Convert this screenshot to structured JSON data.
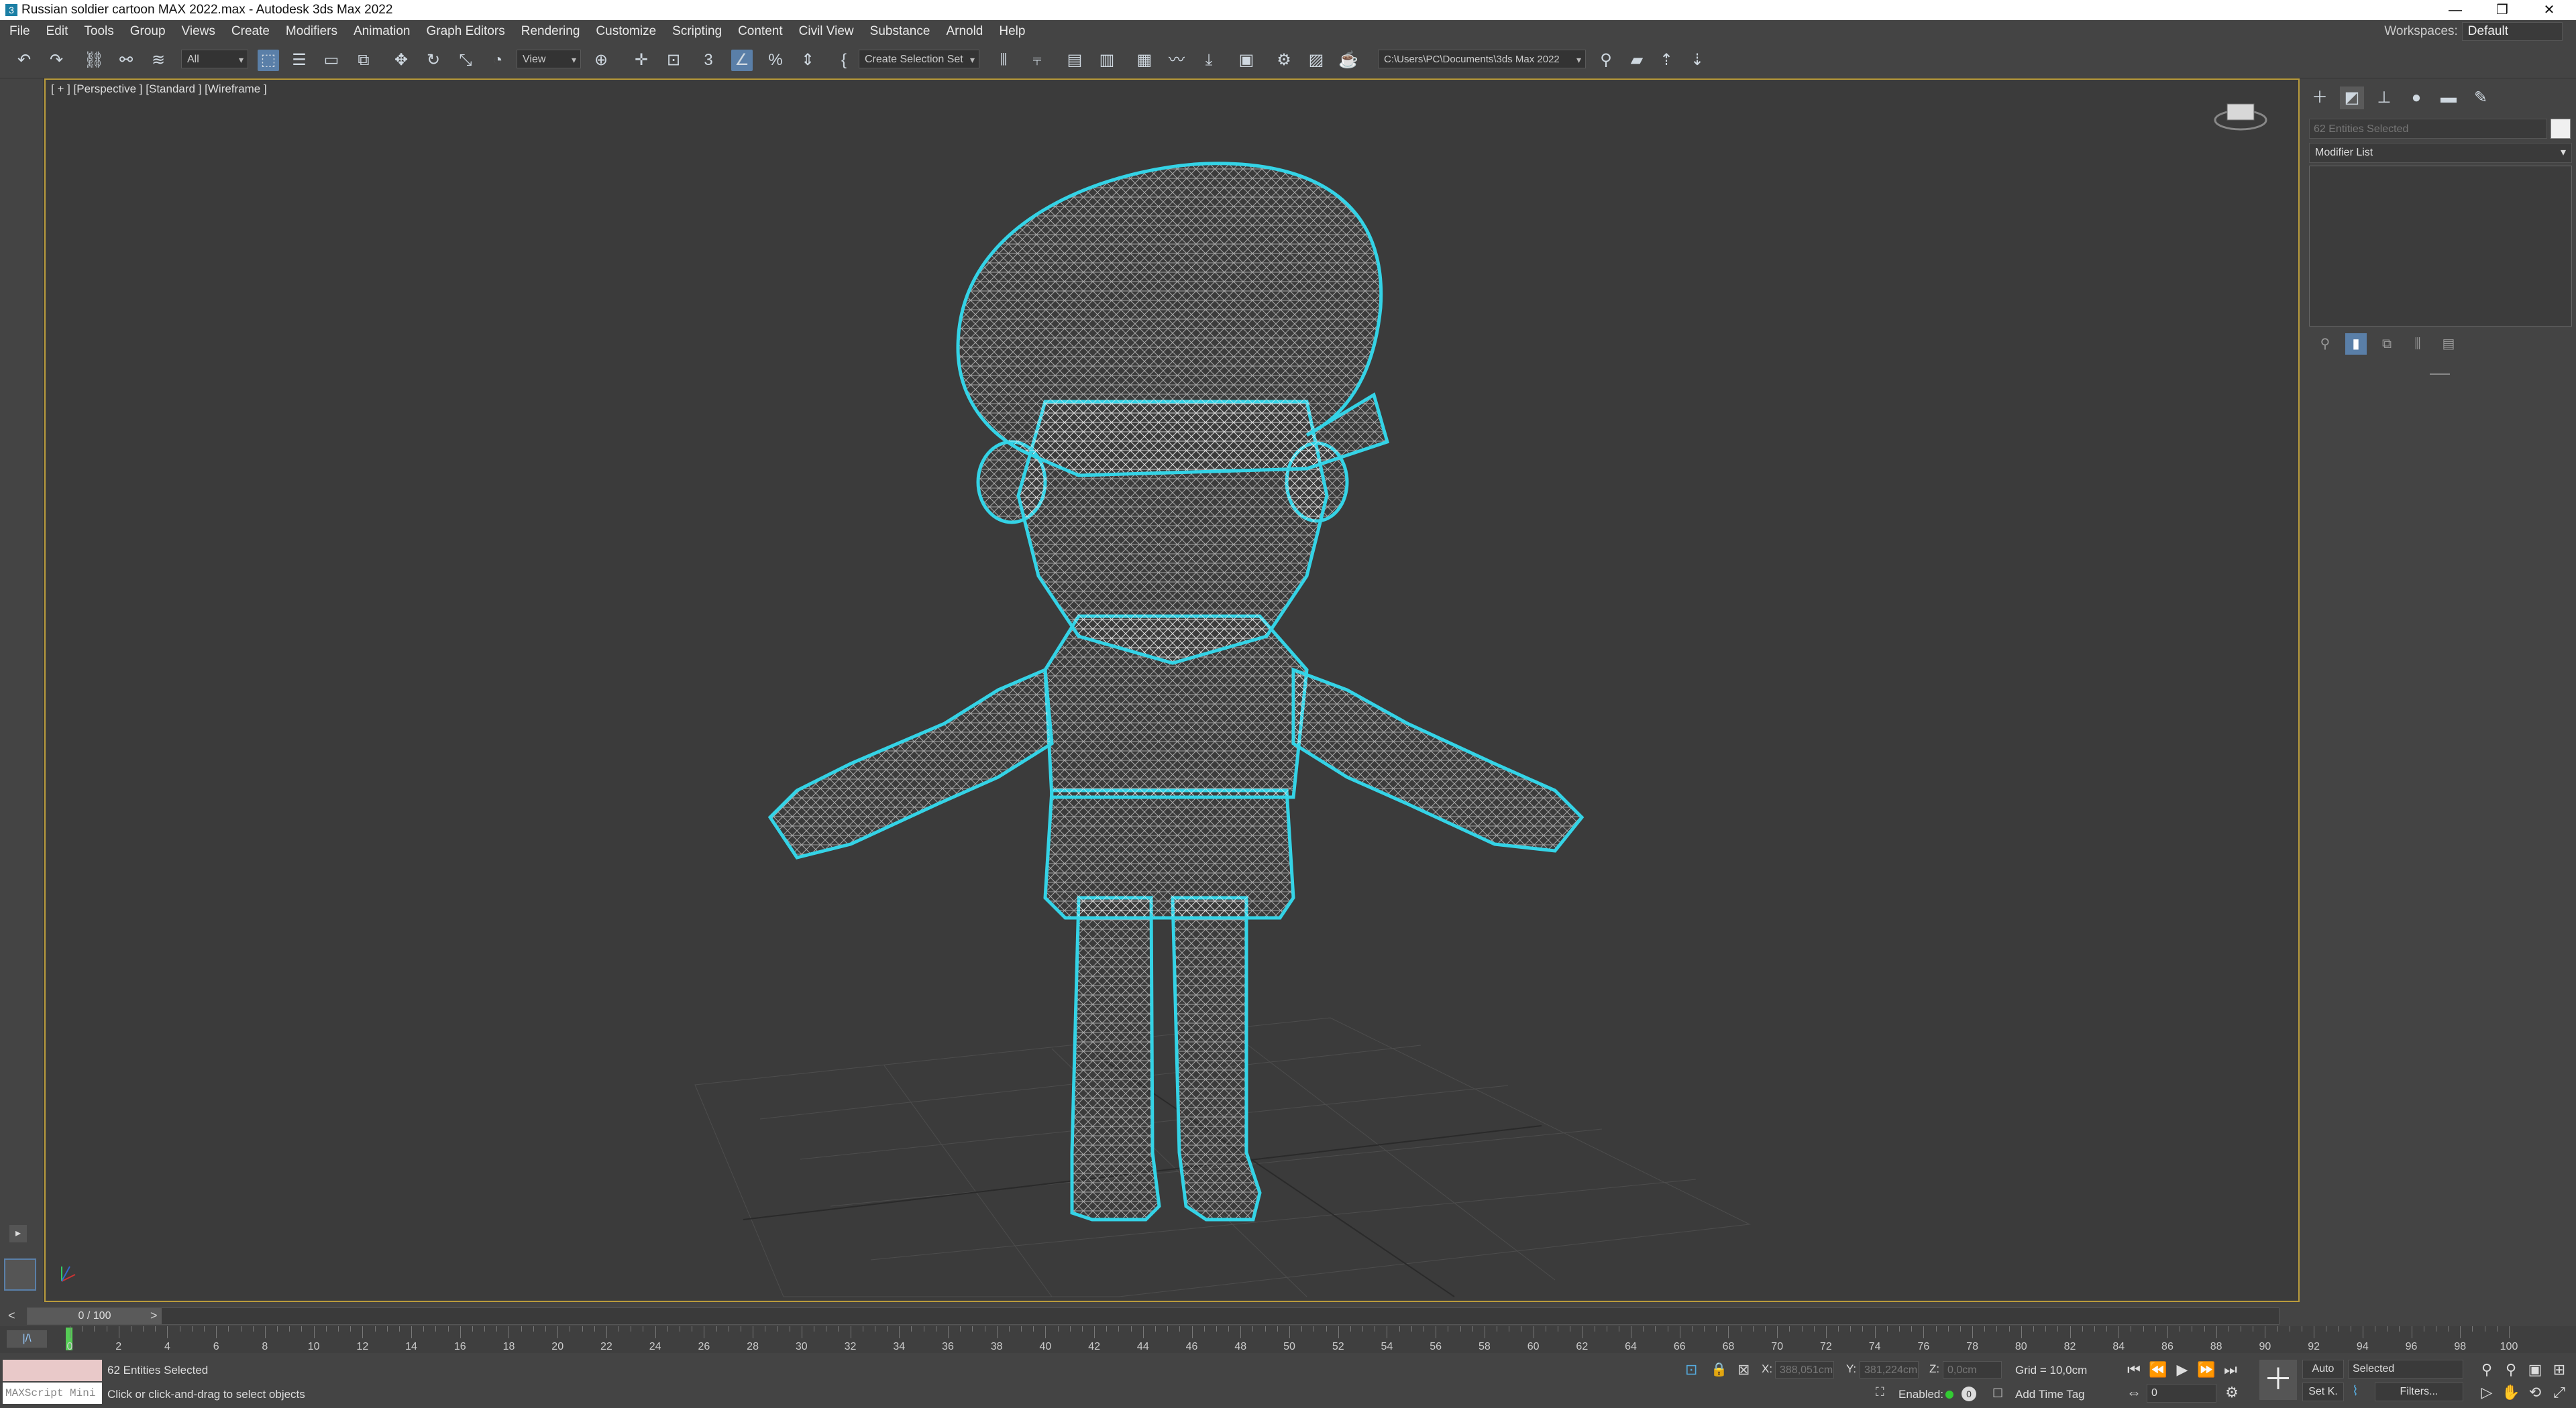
{
  "window": {
    "title": "Russian soldier cartoon MAX 2022.max - Autodesk 3ds Max 2022",
    "minimize": "—",
    "restore": "❐",
    "close": "✕"
  },
  "menu": {
    "items": [
      "File",
      "Edit",
      "Tools",
      "Group",
      "Views",
      "Create",
      "Modifiers",
      "Animation",
      "Graph Editors",
      "Rendering",
      "Customize",
      "Scripting",
      "Content",
      "Civil View",
      "Substance",
      "Arnold",
      "Help"
    ],
    "workspace_label": "Workspaces:",
    "workspace_value": "Default"
  },
  "toolbar": {
    "selection_filter": "All",
    "ref_coord": "View",
    "selection_set": "Create Selection Set",
    "project_path": "C:\\Users\\PC\\Documents\\3ds Max 2022",
    "snap_label": "3",
    "accent": "#5a7fa8"
  },
  "viewport": {
    "label": "[ + ] [Perspective ] [Standard ] [Wireframe ]",
    "wire_color": "#ffffff",
    "selection_outline": "#34d3e6",
    "active_border": "#b99b3c"
  },
  "command_panel": {
    "selection_name": "62 Entities Selected",
    "modifier_list": "Modifier List"
  },
  "timeline": {
    "frame_display": "0 / 100",
    "ticks": [
      "0",
      "2",
      "4",
      "6",
      "8",
      "10",
      "12",
      "14",
      "16",
      "18",
      "20",
      "22",
      "24",
      "26",
      "28",
      "30",
      "32",
      "34",
      "36",
      "38",
      "40",
      "42",
      "44",
      "46",
      "48",
      "50",
      "52",
      "54",
      "56",
      "58",
      "60",
      "62",
      "64",
      "66",
      "68",
      "70",
      "72",
      "74",
      "76",
      "78",
      "80",
      "82",
      "84",
      "86",
      "88",
      "90",
      "92",
      "94",
      "96",
      "98",
      "100"
    ]
  },
  "status": {
    "maxscript": "MAXScript Mini",
    "selection_count": "62 Entities Selected",
    "prompt": "Click or click-and-drag to select objects",
    "x_label": "X:",
    "x_value": "388,051cm",
    "y_label": "Y:",
    "y_value": "381,224cm",
    "z_label": "Z:",
    "z_value": "0,0cm",
    "grid": "Grid = 10,0cm",
    "enabled_label": "Enabled:",
    "add_time_tag": "Add Time Tag",
    "auto_key": "Auto",
    "set_key": "Set K.",
    "key_mode": "Selected",
    "filters": "Filters...",
    "current_frame": "0"
  }
}
